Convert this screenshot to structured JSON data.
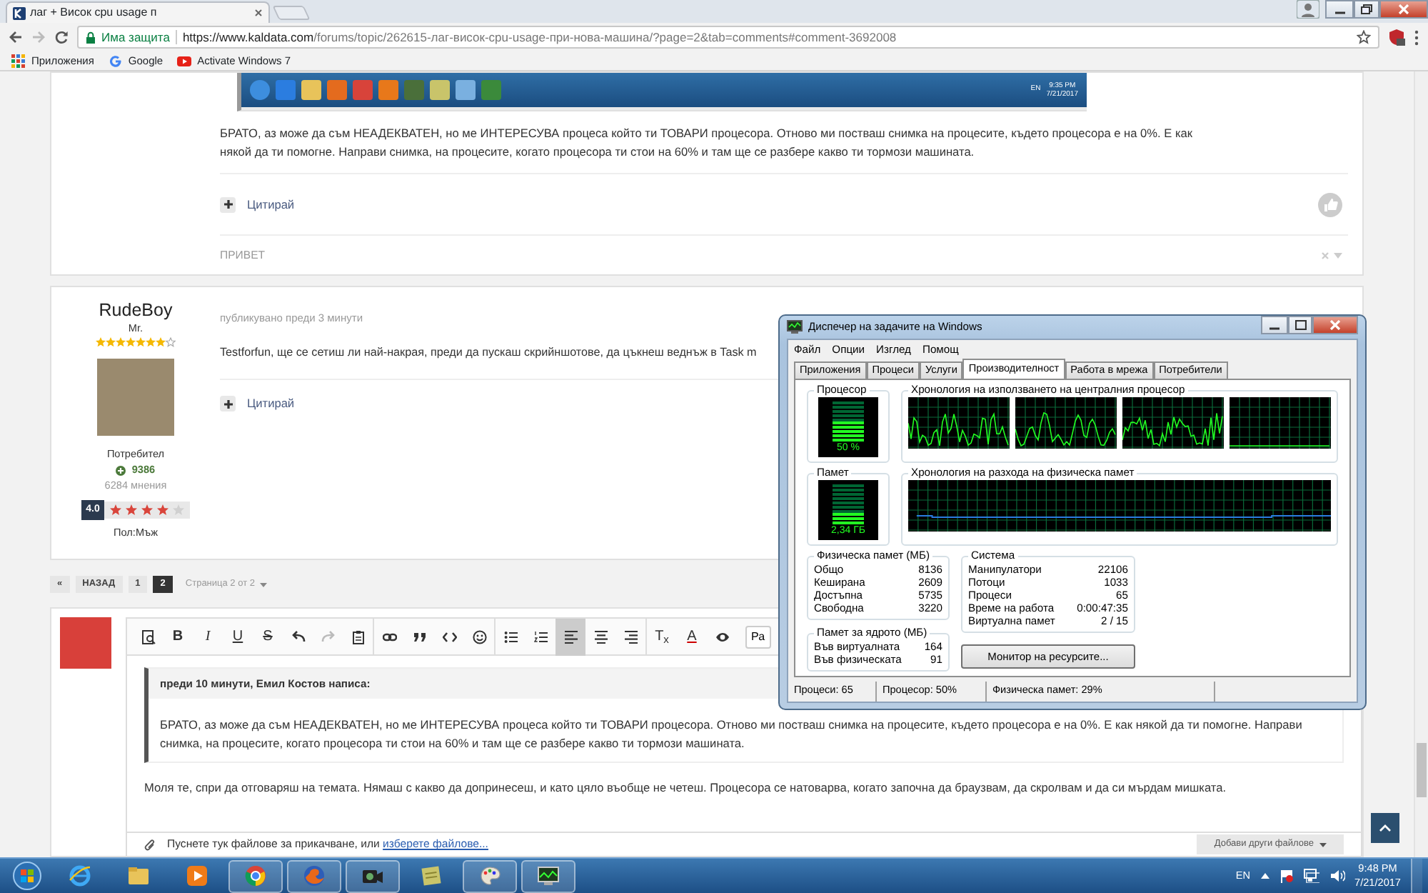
{
  "browser": {
    "tab_title": "лаг + Висок cpu usage п",
    "security_label": "Има защита",
    "url_host": "https://www.kaldata.com",
    "url_path": "/forums/topic/262615-лаг-висок-cpu-usage-при-нова-машина/?page=2&tab=comments#comment-3692008",
    "bookmarks": [
      {
        "kind": "apps",
        "label": "Приложения"
      },
      {
        "kind": "google",
        "label": "Google"
      },
      {
        "kind": "video",
        "label": "Activate Windows 7"
      }
    ]
  },
  "previous_post": {
    "embedded_screenshot": {
      "language": "EN",
      "time": "9:35 PM",
      "date": "7/21/2017"
    },
    "text": "БРАТО, аз може да съм НЕАДЕКВАТЕН, но ме ИНТЕРЕСУВА процеса който ти ТОВАРИ процесора. Отново ми постваш снимка на процесите, където процесора е на 0%. Е как някой да ти помогне. Направи снимка, на процесите, когато процесора ти стои на 60% и там ще се разбере какво ти тормози машината.",
    "quote_label": "Цитирай",
    "signature": "ПРИВЕТ"
  },
  "post": {
    "author": "RudeBoy",
    "rank": {
      "title": "Mr.",
      "stars": 7
    },
    "role": "Потребител",
    "reputation": "9386",
    "post_count": "6284 мнения",
    "rating": {
      "score": "4.0",
      "stars": 4
    },
    "gender": "Пол:Мъж",
    "meta": "публикувано преди 3 минути",
    "text": "Testforfun, ще се сетиш ли най-накрая, преди да пускаш скрийншотове, да цъкнеш веднъж в Task m",
    "quote_label": "Цитирай"
  },
  "pagination": {
    "first": "«",
    "prev": "НАЗАД",
    "pages": [
      {
        "label": "1",
        "selected": false
      },
      {
        "label": "2",
        "selected": true
      }
    ],
    "page_info": "Страница 2 от 2"
  },
  "editor": {
    "toolbar": [
      {
        "kind": "icon",
        "selected": false
      },
      {
        "kind": "text",
        "text": "B",
        "selected": false
      },
      {
        "kind": "text",
        "text": "I",
        "selected": false
      },
      {
        "kind": "text",
        "text": "U",
        "selected": false
      },
      {
        "kind": "text",
        "text": "S",
        "selected": false
      },
      {
        "kind": "icon",
        "selected": false
      },
      {
        "kind": "icon",
        "selected": false
      },
      {
        "kind": "icon",
        "selected": false
      },
      {
        "kind": "divider"
      },
      {
        "kind": "icon",
        "selected": false
      },
      {
        "kind": "icon",
        "selected": false
      },
      {
        "kind": "icon",
        "selected": false
      },
      {
        "kind": "icon",
        "selected": false
      },
      {
        "kind": "divider"
      },
      {
        "kind": "icon",
        "selected": false
      },
      {
        "kind": "icon",
        "selected": false
      },
      {
        "kind": "icon",
        "selected": true
      },
      {
        "kind": "icon",
        "selected": false
      },
      {
        "kind": "icon",
        "selected": false
      },
      {
        "kind": "divider"
      },
      {
        "kind": "text",
        "text": "T$_{x}$",
        "selected": false
      },
      {
        "kind": "text",
        "text": "A",
        "selected": false
      },
      {
        "kind": "icon",
        "selected": false
      }
    ],
    "partial_button": "Ра",
    "quote_header": "преди 10 минути, Емил Костов написа:",
    "quote_text": "БРАТО, аз може да съм НЕАДЕКВАТЕН, но ме ИНТЕРЕСУВА процеса който ти ТОВАРИ процесора. Отново ми постваш снимка на процесите, където процесора е на 0%. Е как някой да ти помогне. Направи снимка, на процесите, когато процесора ти стои на 60% и там ще се разбере какво ти тормози машината.",
    "reply_text": "Моля те, спри да отговаряш на темата. Нямаш с какво да допринесеш, и като цяло въобще не четеш. Процесора се натоварва, когато започна да браузвам, да скролвам и да си мърдам мишката.",
    "attach_text": "Пуснете тук файлове за прикачване, или ",
    "attach_link": "изберете файлове...",
    "add_files_button": "Добави други файлове"
  },
  "task_manager": {
    "title": "Диспечер на задачите на Windows",
    "menu": [
      "Файл",
      "Опции",
      "Изглед",
      "Помощ"
    ],
    "tabs": [
      {
        "label": "Приложения",
        "selected": false
      },
      {
        "label": "Процеси",
        "selected": false
      },
      {
        "label": "Услуги",
        "selected": false
      },
      {
        "label": "Производителност",
        "selected": true
      },
      {
        "label": "Работа в мрежа",
        "selected": false
      },
      {
        "label": "Потребители",
        "selected": false
      }
    ],
    "cpu_meter": {
      "label": "Процесор",
      "reading": "50 %",
      "level": 0.5
    },
    "cpu_history": {
      "label": "Хронология на използването на централния процесор"
    },
    "memory_meter": {
      "label": "Памет",
      "reading": "2,34 ГБ",
      "level": 0.29
    },
    "memory_history": {
      "label": "Хронология на разхода на физическа памет"
    },
    "physical_memory": {
      "title": "Физическа памет (МБ)",
      "rows": [
        {
          "label": "Общо",
          "value": "8136"
        },
        {
          "label": "Кеширана",
          "value": "2609"
        },
        {
          "label": "Достъпна",
          "value": "5735"
        },
        {
          "label": "Свободна",
          "value": "3220"
        }
      ]
    },
    "kernel_memory": {
      "title": "Памет за ядрото (МБ)",
      "rows": [
        {
          "label": "Във виртуалната",
          "value": "164"
        },
        {
          "label": "Във физическата",
          "value": "91"
        }
      ]
    },
    "system": {
      "title": "Система",
      "rows": [
        {
          "label": "Манипулатори",
          "value": "22106"
        },
        {
          "label": "Потоци",
          "value": "1033"
        },
        {
          "label": "Процеси",
          "value": "65"
        },
        {
          "label": "Време на работа",
          "value": "0:00:47:35"
        },
        {
          "label": "Виртуална памет",
          "value": "2 / 15"
        }
      ]
    },
    "resource_button": "Монитор на ресурсите...",
    "status": [
      "Процеси: 65",
      "Процесор: 50%",
      "Физическа памет: 29%"
    ]
  },
  "taskbar": {
    "items": [
      {
        "open": false
      },
      {
        "open": false
      },
      {
        "open": false
      },
      {
        "open": true
      },
      {
        "open": true
      },
      {
        "open": true
      },
      {
        "open": false
      },
      {
        "open": true
      },
      {
        "open": true
      }
    ],
    "language": "EN",
    "time": "9:48 PM",
    "date": "7/21/2017"
  }
}
